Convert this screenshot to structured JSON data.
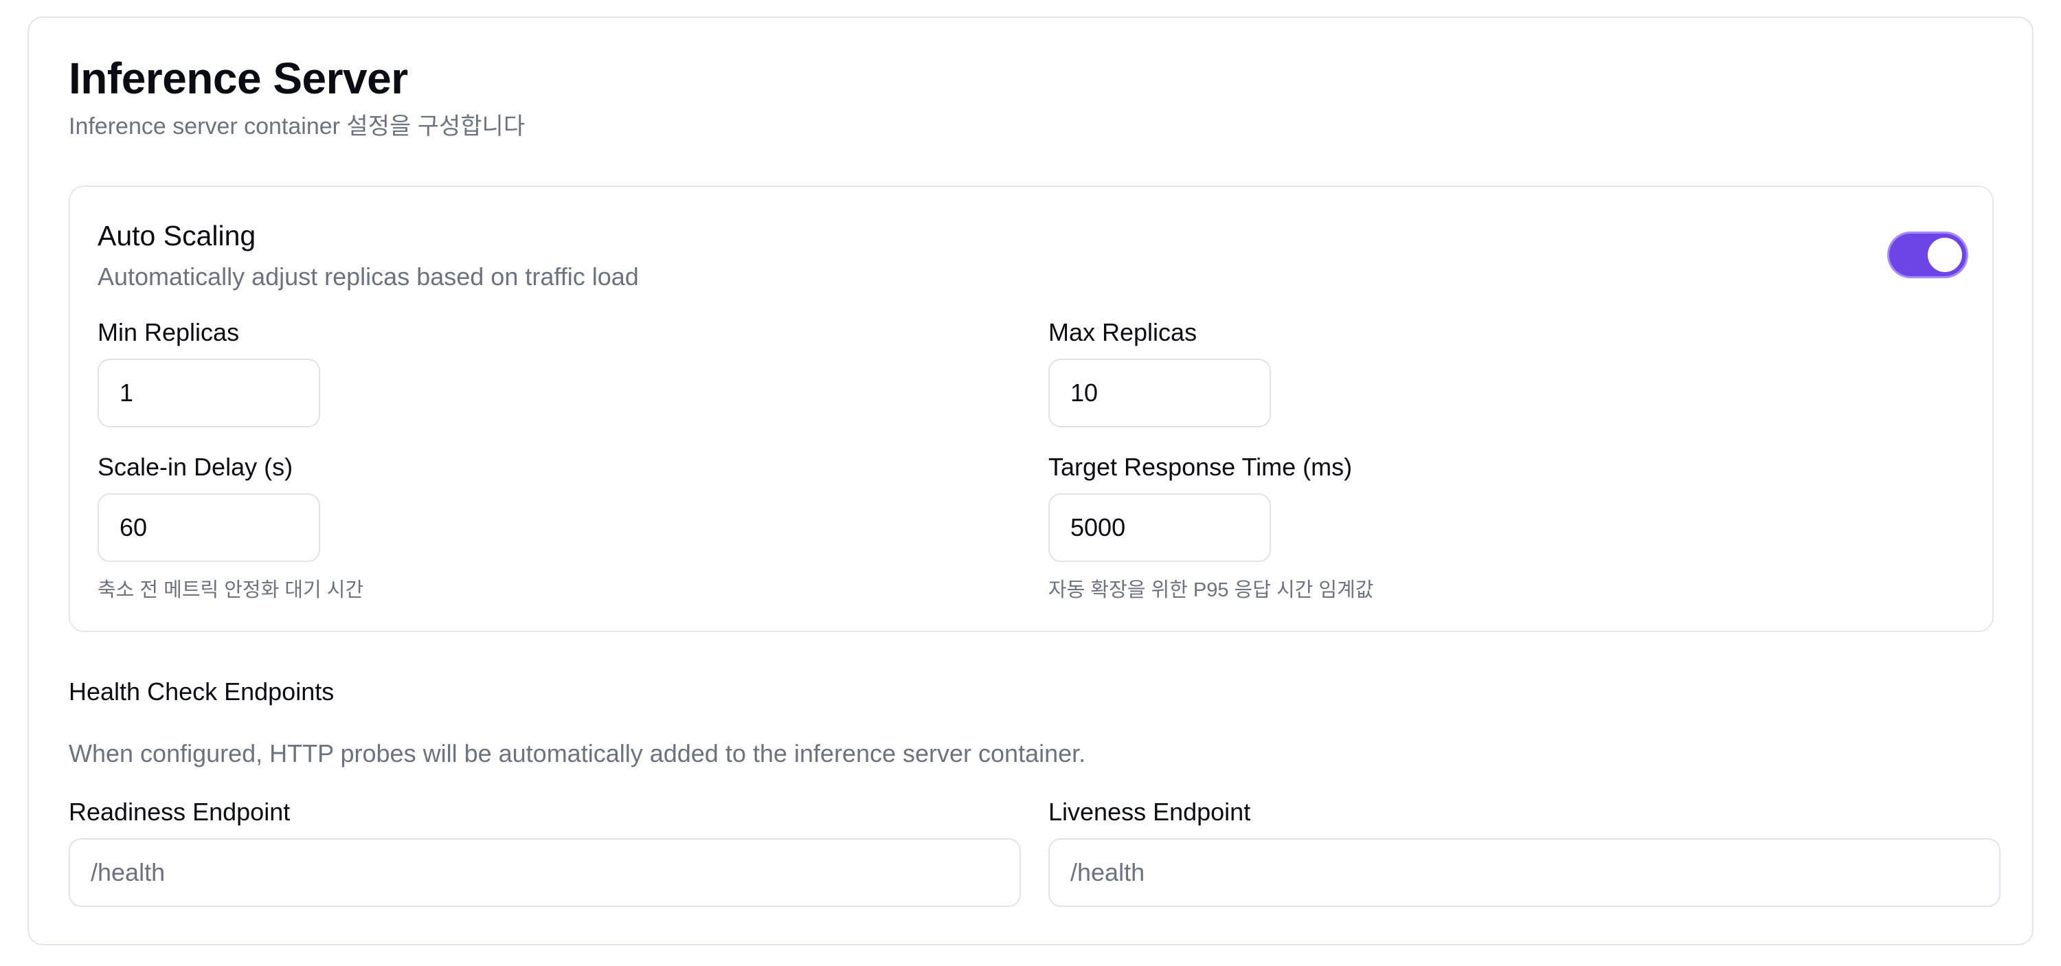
{
  "header": {
    "title": "Inference Server",
    "subtitle": "Inference server container 설정을 구성합니다"
  },
  "auto_scaling": {
    "title": "Auto Scaling",
    "description": "Automatically adjust replicas based on traffic load",
    "enabled": true,
    "toggle_color": "#6d45e6",
    "min_replicas": {
      "label": "Min Replicas",
      "value": "1"
    },
    "max_replicas": {
      "label": "Max Replicas",
      "value": "10"
    },
    "scale_in_delay": {
      "label": "Scale-in Delay (s)",
      "value": "60",
      "hint": "축소 전 메트릭 안정화 대기 시간"
    },
    "target_response_time": {
      "label": "Target Response Time (ms)",
      "value": "5000",
      "hint": "자동 확장을 위한 P95 응답 시간 임계값"
    }
  },
  "health_check": {
    "title": "Health Check Endpoints",
    "description": "When configured, HTTP probes will be automatically added to the inference server container.",
    "readiness": {
      "label": "Readiness Endpoint",
      "value": "",
      "placeholder": "/health"
    },
    "liveness": {
      "label": "Liveness Endpoint",
      "value": "",
      "placeholder": "/health"
    }
  }
}
